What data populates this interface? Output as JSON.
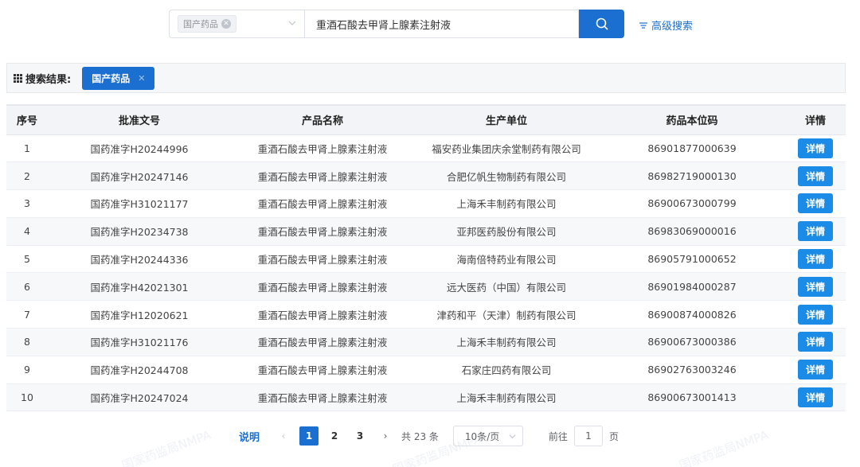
{
  "search": {
    "category_chip": "国产药品",
    "keyword": "重酒石酸去甲肾上腺素注射液",
    "advanced_label": "高级搜索"
  },
  "results": {
    "label": "搜索结果:",
    "tag": "国产药品"
  },
  "table": {
    "headers": [
      "序号",
      "批准文号",
      "产品名称",
      "生产单位",
      "药品本位码",
      "详情"
    ],
    "detail_label": "详情",
    "rows": [
      {
        "no": "1",
        "approval": "国药准字H20244996",
        "name": "重酒石酸去甲肾上腺素注射液",
        "maker": "福安药业集团庆余堂制药有限公司",
        "code": "86901877000639"
      },
      {
        "no": "2",
        "approval": "国药准字H20247146",
        "name": "重酒石酸去甲肾上腺素注射液",
        "maker": "合肥亿帆生物制药有限公司",
        "code": "86982719000130"
      },
      {
        "no": "3",
        "approval": "国药准字H31021177",
        "name": "重酒石酸去甲肾上腺素注射液",
        "maker": "上海禾丰制药有限公司",
        "code": "86900673000799"
      },
      {
        "no": "4",
        "approval": "国药准字H20234738",
        "name": "重酒石酸去甲肾上腺素注射液",
        "maker": "亚邦医药股份有限公司",
        "code": "86983069000016"
      },
      {
        "no": "5",
        "approval": "国药准字H20244336",
        "name": "重酒石酸去甲肾上腺素注射液",
        "maker": "海南倍特药业有限公司",
        "code": "86905791000652"
      },
      {
        "no": "6",
        "approval": "国药准字H42021301",
        "name": "重酒石酸去甲肾上腺素注射液",
        "maker": "远大医药（中国）有限公司",
        "code": "86901984000287"
      },
      {
        "no": "7",
        "approval": "国药准字H12020621",
        "name": "重酒石酸去甲肾上腺素注射液",
        "maker": "津药和平（天津）制药有限公司",
        "code": "86900874000826"
      },
      {
        "no": "8",
        "approval": "国药准字H31021176",
        "name": "重酒石酸去甲肾上腺素注射液",
        "maker": "上海禾丰制药有限公司",
        "code": "86900673000386"
      },
      {
        "no": "9",
        "approval": "国药准字H20244708",
        "name": "重酒石酸去甲肾上腺素注射液",
        "maker": "石家庄四药有限公司",
        "code": "86902763003246"
      },
      {
        "no": "10",
        "approval": "国药准字H20247024",
        "name": "重酒石酸去甲肾上腺素注射液",
        "maker": "上海禾丰制药有限公司",
        "code": "86900673001413"
      }
    ]
  },
  "pagination": {
    "note": "说明",
    "pages": [
      "1",
      "2",
      "3"
    ],
    "current": "1",
    "total": "共 23 条",
    "page_size": "10条/页",
    "goto_label": "前往",
    "goto_value": "1",
    "page_unit": "页"
  },
  "watermark": "国家药监局NMPA",
  "colors": {
    "accent": "#1a6fd1",
    "detail_button": "#1a8ce8"
  }
}
